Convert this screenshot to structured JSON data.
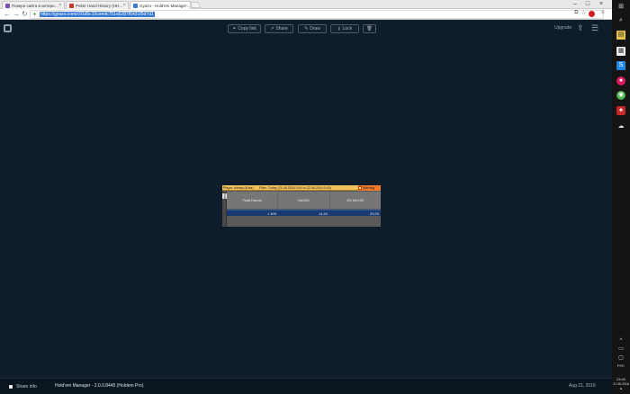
{
  "browser": {
    "tabs": [
      {
        "label": "Покерн сайта в интерн…",
        "color": "#7a4fb0"
      },
      {
        "label": "Poker Hand History (HH…",
        "color": "#c0392b"
      },
      {
        "label": "Gyazo - Hold'em Manager…",
        "color": "#3a7bd5"
      }
    ],
    "url": "https://gyazo.com/c91d5c15ceedc751a5287f6431f5d7d1"
  },
  "toolbar": {
    "copy_link": "Copy link",
    "share": "Share",
    "draw": "Draw",
    "lock": "Lock",
    "upgrade": "Upgrade"
  },
  "shot": {
    "player": "Player: slimka (40az)",
    "filter": "Filter: Today (21.08.2016 0:00 to 22.08.2016 0:00)",
    "warning": "Warning",
    "side_label": "Total",
    "columns": [
      "Total Hands",
      "bb/100",
      "EV bb/100"
    ],
    "row": [
      "1 409",
      "14,34",
      "23,93"
    ]
  },
  "status": {
    "share_info": "Share info",
    "app_title": "Hold'em Manager - 2.0.0.8445 (Holdem Pro)",
    "date": "Aug 21, 2016"
  },
  "taskbar": {
    "lang": "РУС",
    "time": "23:40",
    "date": "21.08.2016"
  }
}
